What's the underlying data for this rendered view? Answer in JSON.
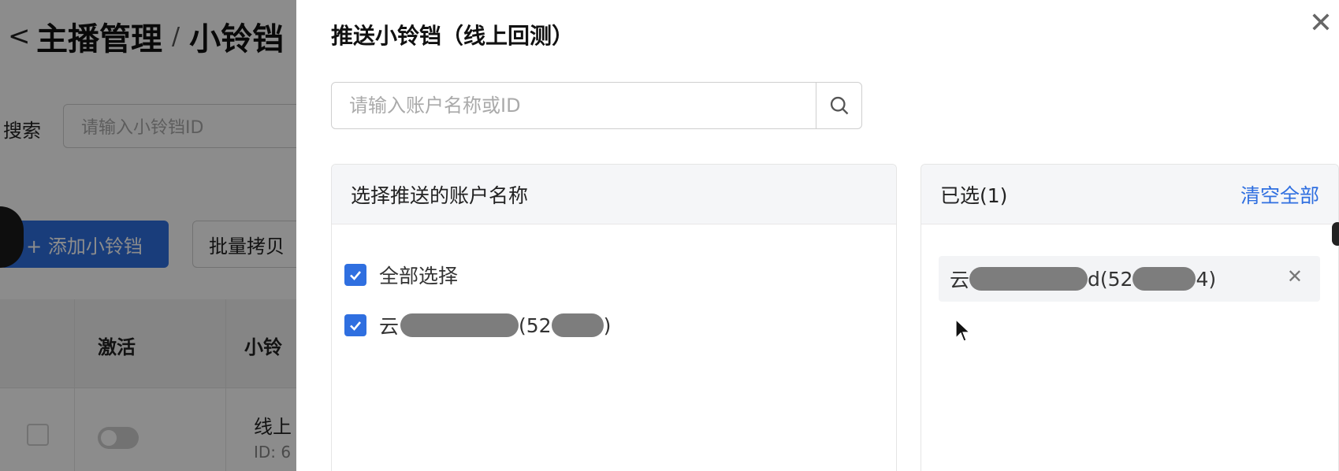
{
  "background": {
    "back_glyph": "<",
    "breadcrumb": [
      "主播管理",
      "/",
      "小铃铛"
    ],
    "search_label": "搜索",
    "search_placeholder": "请输入小铃铛ID",
    "add_button": "+ 添加小铃铛",
    "batch_copy_button": "批量拷贝",
    "columns": [
      "激活",
      "小铃"
    ],
    "row": {
      "name": "线上",
      "id": "ID: 6"
    }
  },
  "drawer": {
    "title": "推送小铃铛（线上回测）",
    "close_glyph": "✕",
    "search_placeholder": "请输入账户名称或ID",
    "left_panel": {
      "title": "选择推送的账户名称",
      "select_all": "全部选择",
      "items": [
        {
          "prefix": "云",
          "id_prefix": "(52",
          "suffix": ")",
          "checked": true
        }
      ]
    },
    "right_panel": {
      "title": "已选(1)",
      "clear_all": "清空全部",
      "selected": [
        {
          "prefix": "云",
          "middle": "d(52",
          "suffix": "4)",
          "remove_glyph": "✕"
        }
      ]
    }
  },
  "colors": {
    "accent": "#2f6fe0",
    "overlay": "rgba(0,0,0,0.45)"
  }
}
